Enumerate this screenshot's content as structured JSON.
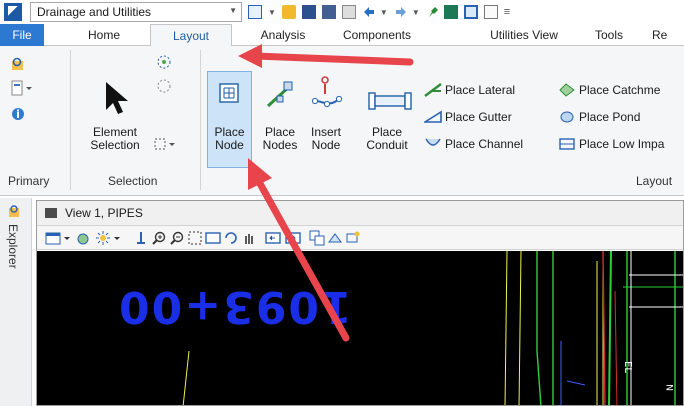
{
  "quick_access": {
    "workspace": "Drainage and Utilities",
    "icons": [
      "app-logo-icon",
      "v8-icon",
      "open-folder-icon",
      "save-icon",
      "save-settings-icon",
      "paste-icon",
      "undo-icon",
      "redo-icon",
      "pin-icon",
      "print-icon",
      "monitor-icon",
      "page-icon"
    ],
    "overflow": "≡"
  },
  "tabs": [
    "File",
    "Home",
    "Layout",
    "Analysis",
    "Components",
    "Utilities View",
    "Tools",
    "Re"
  ],
  "active_tab": "Layout",
  "ribbon": {
    "primary": {
      "label": "Primary"
    },
    "selection": {
      "label": "Selection",
      "element_selection_line1": "Element",
      "element_selection_line2": "Selection"
    },
    "layout": {
      "label": "Layout",
      "place_node_l1": "Place",
      "place_node_l2": "Node",
      "place_nodes_l1": "Place",
      "place_nodes_l2": "Nodes",
      "insert_node_l1": "Insert",
      "insert_node_l2": "Node",
      "place_conduit_l1": "Place",
      "place_conduit_l2": "Conduit",
      "place_lateral": "Place Lateral",
      "place_gutter": "Place Gutter",
      "place_channel": "Place Channel",
      "place_catchment": "Place Catchme",
      "place_pond": "Place Pond",
      "place_low_impact": "Place Low Impa"
    }
  },
  "explorer_label": "Explorer",
  "view": {
    "title": "View 1, PIPES",
    "station_label": "1093+00"
  },
  "colors": {
    "file_tab": "#2b79d0",
    "arrow": "#e8444c",
    "station_text": "#1a2ee8"
  }
}
